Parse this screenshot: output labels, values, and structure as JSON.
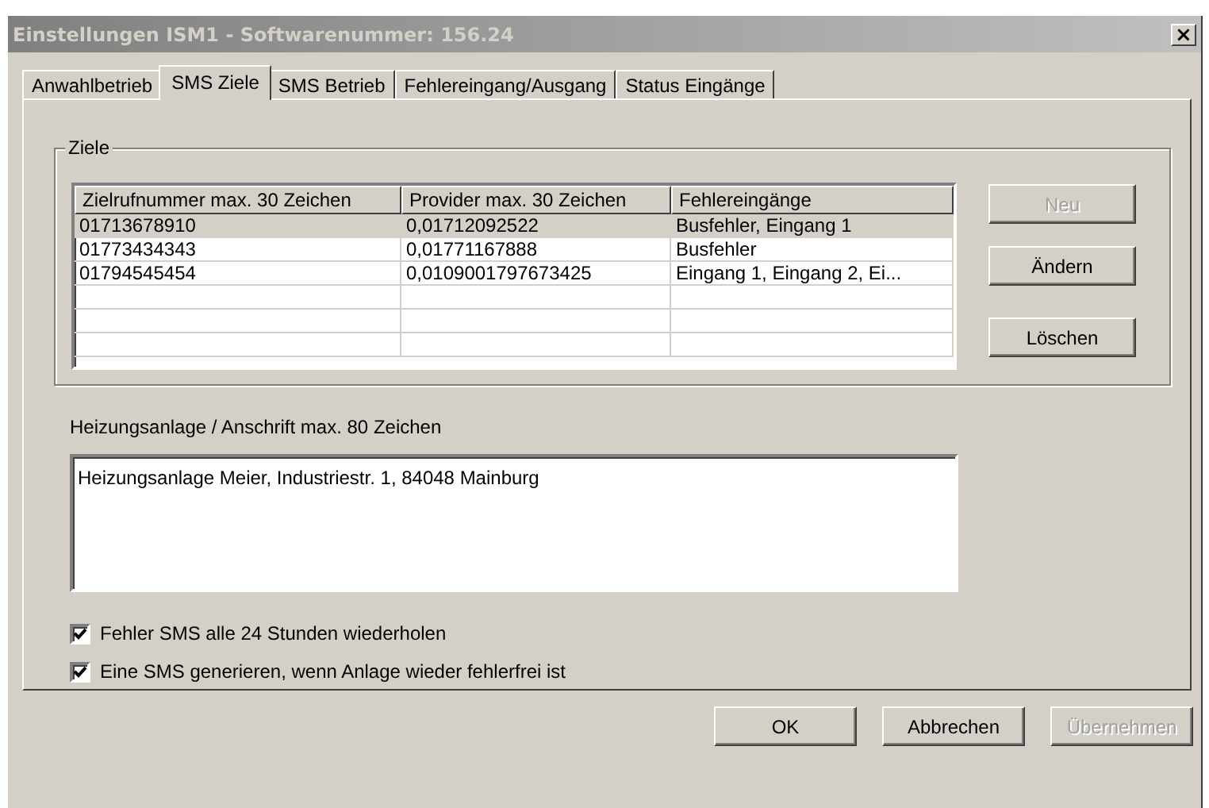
{
  "window": {
    "title": "Einstellungen ISM1 - Softwarenummer: 156.24",
    "close": "×"
  },
  "tabs": [
    {
      "label": "Anwahlbetrieb",
      "selected": false
    },
    {
      "label": "SMS Ziele",
      "selected": true
    },
    {
      "label": "SMS Betrieb",
      "selected": false
    },
    {
      "label": "Fehlereingang/Ausgang",
      "selected": false
    },
    {
      "label": "Status Eingänge",
      "selected": false
    }
  ],
  "group": {
    "title": "Ziele"
  },
  "table": {
    "columns": [
      "Zielrufnummer max. 30 Zeichen",
      "Provider max. 30 Zeichen",
      "Fehlereingänge"
    ],
    "rows": [
      {
        "cells": [
          "01713678910",
          "0,01712092522",
          "Busfehler, Eingang 1"
        ],
        "selected": true
      },
      {
        "cells": [
          "01773434343",
          "0,01771167888",
          "Busfehler"
        ],
        "selected": false
      },
      {
        "cells": [
          "01794545454",
          "0,0109001797673425",
          "Eingang 1, Eingang 2, Ei..."
        ],
        "selected": false
      }
    ]
  },
  "side_buttons": [
    {
      "label": "Neu",
      "disabled": true
    },
    {
      "label": "Ändern",
      "disabled": false
    },
    {
      "label": "Löschen",
      "disabled": false
    }
  ],
  "address": {
    "label": "Heizungsanlage / Anschrift max. 80 Zeichen",
    "value": "Heizungsanlage Meier, Industriestr. 1, 84048 Mainburg"
  },
  "checkboxes": [
    {
      "label": "Fehler SMS alle 24 Stunden wiederholen",
      "checked": true
    },
    {
      "label": "Eine SMS generieren, wenn Anlage wieder fehlerfrei ist",
      "checked": true
    }
  ],
  "buttons": [
    {
      "label": "OK",
      "disabled": false
    },
    {
      "label": "Abbrechen",
      "disabled": false
    },
    {
      "label": "Übernehmen",
      "disabled": true
    }
  ]
}
